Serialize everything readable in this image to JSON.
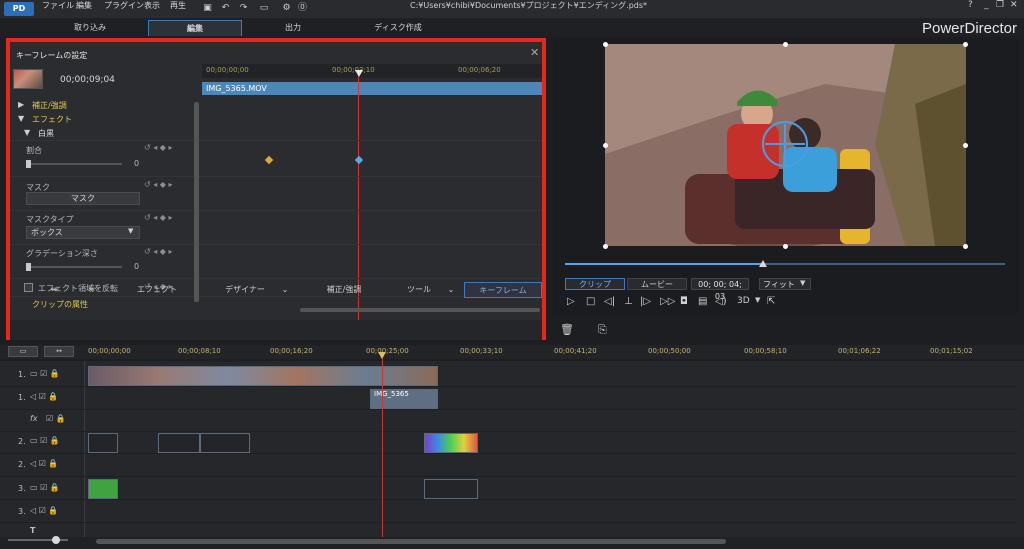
{
  "app": {
    "logo": "PD",
    "brand": "PowerDirector"
  },
  "menu": [
    "ファイル",
    "編集",
    "プラグイン",
    "表示",
    "再生"
  ],
  "title_icons": [
    "save-icon",
    "undo-icon",
    "redo-icon",
    "render-icon",
    "settings-icon",
    "upgrade-icon"
  ],
  "title_path": "C:¥Users¥chibi¥Documents¥プロジェクト¥エンディング.pds*",
  "window_buttons": [
    "?",
    "_",
    "❐",
    "✕"
  ],
  "tabs": [
    "取り込み",
    "編集",
    "出力",
    "ディスク作成"
  ],
  "keyframe": {
    "title": "キーフレームの設定",
    "close": "✕",
    "time": "00;00;09;04",
    "ruler": [
      "00;00;00;00",
      "00;00;03;10",
      "00;00;06;20"
    ],
    "clip_name": "IMG_5365.MOV",
    "sections": {
      "correction": "補正/強調",
      "effect": "エフェクト",
      "bw": "白黒"
    },
    "ratio_label": "割合",
    "ratio_value": "0",
    "mask_label": "マスク",
    "mask_button": "マスク",
    "masktype_label": "マスクタイプ",
    "masktype_value": "ボックス",
    "gradation_label": "グラデーション深さ",
    "gradation_value": "0",
    "invert_label": "エフェクト領域を反転",
    "clip_attr": "クリップの属性"
  },
  "kf_toolbar": [
    "エフェクト",
    "デザイナー",
    "補正/強調",
    "ツール",
    "キーフレーム"
  ],
  "preview": {
    "clip_btn": "クリップ",
    "movie_btn": "ムービー",
    "time": "00; 00; 04; 03",
    "fit": "フィット",
    "threed": "3D"
  },
  "timeline": {
    "ruler": [
      "00;00;00;00",
      "00;00;08;10",
      "00;00;16;20",
      "00;00;25;00",
      "00;00;33;10",
      "00;00;41;20",
      "00;00;50;00",
      "00;00;58;10",
      "00;01;06;22",
      "00;01;15;02"
    ],
    "tracks": [
      "1.",
      "1.",
      "fx",
      "2.",
      "2.",
      "3.",
      "3.",
      "T"
    ],
    "audio_clip": "IMG_5365"
  },
  "colors": {
    "accent": "#3d7ac0",
    "highlight": "#e8261c",
    "effect_yellow": "#e0c84a"
  }
}
